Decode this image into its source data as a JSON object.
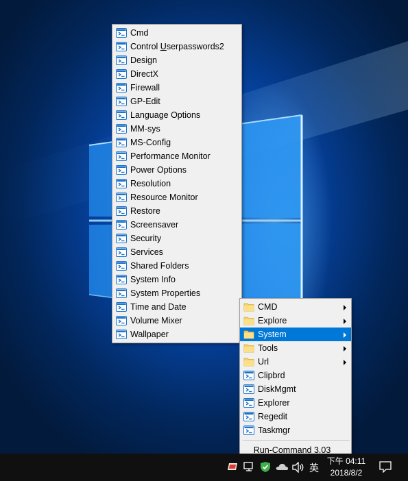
{
  "main_menu": {
    "items": [
      {
        "label": "Cmd"
      },
      {
        "label_pre": "Control ",
        "label_u": "U",
        "label_post": "serpasswords2"
      },
      {
        "label": "Design"
      },
      {
        "label": "DirectX"
      },
      {
        "label": "Firewall"
      },
      {
        "label": "GP-Edit"
      },
      {
        "label": "Language Options"
      },
      {
        "label": "MM-sys"
      },
      {
        "label": "MS-Config"
      },
      {
        "label": "Performance Monitor"
      },
      {
        "label": "Power Options"
      },
      {
        "label": "Resolution"
      },
      {
        "label": "Resource Monitor"
      },
      {
        "label": "Restore"
      },
      {
        "label": "Screensaver"
      },
      {
        "label": "Security"
      },
      {
        "label": "Services"
      },
      {
        "label": "Shared Folders"
      },
      {
        "label": "System Info"
      },
      {
        "label": "System Properties"
      },
      {
        "label": "Time and Date"
      },
      {
        "label": "Volume Mixer"
      },
      {
        "label": "Wallpaper"
      }
    ]
  },
  "sub_menu": {
    "folders": [
      {
        "label": "CMD"
      },
      {
        "label": "Explore"
      },
      {
        "label": "System"
      },
      {
        "label": "Tools"
      },
      {
        "label": "Url"
      }
    ],
    "apps": [
      {
        "label": "Clipbrd"
      },
      {
        "label": "DiskMgmt"
      },
      {
        "label": "Explorer"
      },
      {
        "label": "Regedit"
      },
      {
        "label": "Taskmgr"
      }
    ],
    "footer": "Run-Command 3.03"
  },
  "taskbar": {
    "ime": "英",
    "time": "下午 04:11",
    "date": "2018/8/2"
  },
  "colors": {
    "menu_bg": "#f0f0f0",
    "highlight": "#0078d7",
    "taskbar": "#101010"
  }
}
